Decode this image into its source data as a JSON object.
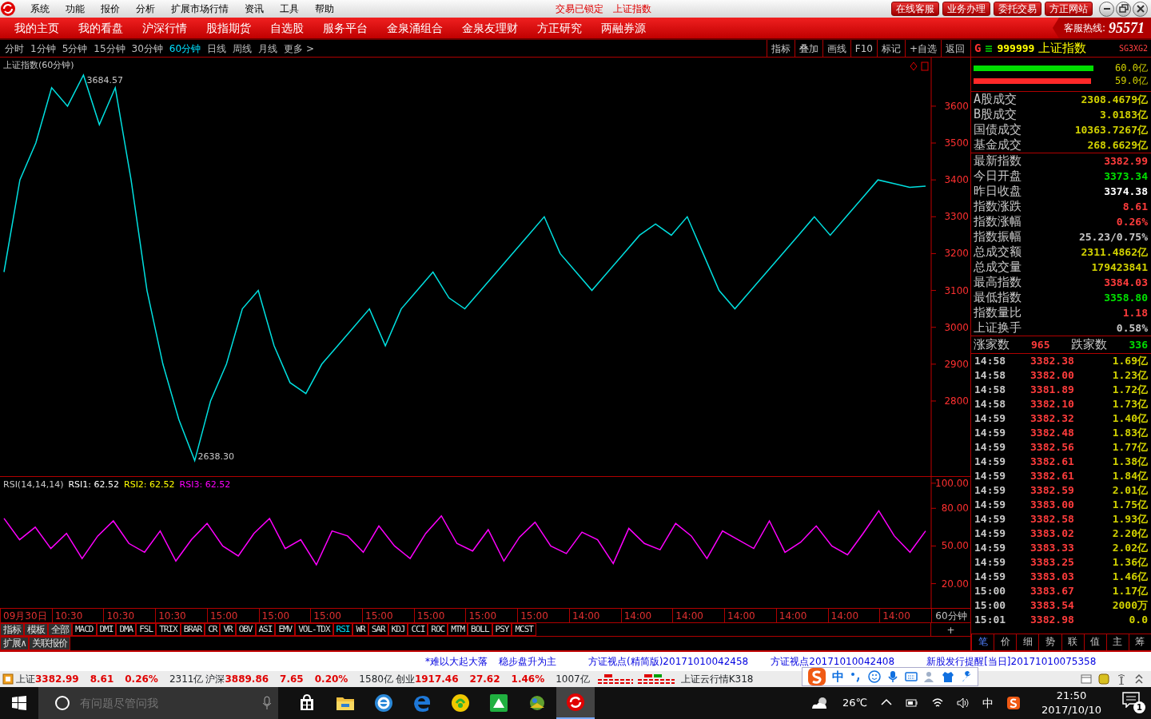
{
  "menu_bar": {
    "items": [
      "系统",
      "功能",
      "报价",
      "分析",
      "扩展市场行情",
      "资讯",
      "工具",
      "帮助"
    ],
    "status": [
      "交易已锁定",
      "上证指数"
    ],
    "buttons": [
      "在线客服",
      "业务办理",
      "委托交易",
      "方正网站"
    ]
  },
  "nav": {
    "items": [
      "我的主页",
      "我的看盘",
      "沪深行情",
      "股指期货",
      "自选股",
      "服务平台",
      "金泉涌组合",
      "金泉友理财",
      "方正研究",
      "两融券源"
    ],
    "hotline_label": "客服热线:",
    "hotline_number": "95571"
  },
  "periods": [
    {
      "label": "分时",
      "selected": false
    },
    {
      "label": "1分钟",
      "selected": false
    },
    {
      "label": "5分钟",
      "selected": false
    },
    {
      "label": "15分钟",
      "selected": false
    },
    {
      "label": "30分钟",
      "selected": false
    },
    {
      "label": "60分钟",
      "selected": true
    },
    {
      "label": "日线",
      "selected": false
    },
    {
      "label": "周线",
      "selected": false
    },
    {
      "label": "月线",
      "selected": false
    },
    {
      "label": "更多 >",
      "selected": false
    }
  ],
  "chart_tools": [
    "指标",
    "叠加",
    "画线",
    "F10",
    "标记",
    "+自选",
    "返回"
  ],
  "price_chart": {
    "title": "上证指数(60分钟)",
    "chart_data": {
      "type": "line",
      "ylim": [
        2594,
        3732
      ],
      "yticks": [
        2800,
        2900,
        3000,
        3100,
        3200,
        3300,
        3400,
        3500,
        3600
      ],
      "series": [
        {
          "color": "#00e0e0",
          "values": [
            3150,
            3400,
            3500,
            3650,
            3600,
            3684.57,
            3550,
            3650,
            3400,
            3100,
            2900,
            2750,
            2638.3,
            2800,
            2900,
            3050,
            3100,
            2950,
            2850,
            2820,
            2900,
            2950,
            3000,
            3050,
            2950,
            3050,
            3100,
            3150,
            3080,
            3050,
            3100,
            3150,
            3200,
            3250,
            3300,
            3200,
            3150,
            3100,
            3150,
            3200,
            3250,
            3280,
            3250,
            3300,
            3200,
            3100,
            3050,
            3100,
            3150,
            3200,
            3250,
            3300,
            3250,
            3300,
            3350,
            3400,
            3390,
            3380,
            3383
          ]
        }
      ],
      "annotations": [
        "3684.57",
        "2638.30"
      ]
    }
  },
  "rsi_chart": {
    "title": "RSI(14,14,14)",
    "readings": [
      {
        "label": "RSI1:",
        "value": "62.52",
        "color": "#ffffff"
      },
      {
        "label": "RSI2:",
        "value": "62.52",
        "color": "#ffff00"
      },
      {
        "label": "RSI3:",
        "value": "62.52",
        "color": "#ff00ff"
      }
    ],
    "chart_data": {
      "type": "line",
      "ylim": [
        0,
        105
      ],
      "yticks": [
        {
          "value": 20,
          "label": "20.00"
        },
        {
          "value": 50,
          "label": "50.00"
        },
        {
          "value": 80,
          "label": "80.00"
        },
        {
          "value": 100,
          "label": "100.00"
        }
      ],
      "series": [
        {
          "color": "#ff00ff",
          "values": [
            72,
            55,
            65,
            48,
            60,
            40,
            58,
            70,
            52,
            45,
            62,
            38,
            55,
            68,
            50,
            42,
            60,
            72,
            48,
            55,
            35,
            62,
            58,
            45,
            66,
            50,
            40,
            60,
            74,
            52,
            46,
            63,
            38,
            57,
            69,
            50,
            44,
            61,
            55,
            36,
            64,
            52,
            47,
            68,
            58,
            40,
            62,
            55,
            48,
            70,
            45,
            53,
            66,
            50,
            43,
            60,
            78,
            58,
            45,
            62
          ]
        }
      ]
    }
  },
  "time_axis": [
    "09月30日",
    "10:30",
    "10:30",
    "10:30",
    "15:00",
    "15:00",
    "15:00",
    "15:00",
    "15:00",
    "15:00",
    "15:00",
    "14:00",
    "14:00",
    "14:00",
    "14:00",
    "14:00",
    "14:00",
    "14:00"
  ],
  "period_label": "60分钟",
  "period_plus": "+",
  "indicator_tabs": [
    {
      "label": "指标",
      "selected": false
    },
    {
      "label": "模板",
      "selected": false
    },
    {
      "label": "全部",
      "selected": false
    },
    {
      "label": "MACD",
      "selected": false
    },
    {
      "label": "DMI",
      "selected": false
    },
    {
      "label": "DMA",
      "selected": false
    },
    {
      "label": "FSL",
      "selected": false
    },
    {
      "label": "TRIX",
      "selected": false
    },
    {
      "label": "BRAR",
      "selected": false
    },
    {
      "label": "CR",
      "selected": false
    },
    {
      "label": "VR",
      "selected": false
    },
    {
      "label": "OBV",
      "selected": false
    },
    {
      "label": "ASI",
      "selected": false
    },
    {
      "label": "EMV",
      "selected": false
    },
    {
      "label": "VOL-TDX",
      "selected": false
    },
    {
      "label": "RSI",
      "selected": true
    },
    {
      "label": "WR",
      "selected": false
    },
    {
      "label": "SAR",
      "selected": false
    },
    {
      "label": "KDJ",
      "selected": false
    },
    {
      "label": "CCI",
      "selected": false
    },
    {
      "label": "ROC",
      "selected": false
    },
    {
      "label": "MTM",
      "selected": false
    },
    {
      "label": "BOLL",
      "selected": false
    },
    {
      "label": "PSY",
      "selected": false
    },
    {
      "label": "MCST",
      "selected": false
    }
  ],
  "extra_tabs": [
    "扩展∧",
    "关联报价"
  ],
  "quote_panel": {
    "marker": "G",
    "code": "999999",
    "name": "上证指数",
    "badge": "SG3XG2",
    "bars": [
      {
        "color": "#00dd00",
        "level": 0.97,
        "value": "60.0亿"
      },
      {
        "color": "#ff2828",
        "level": 0.95,
        "value": "59.0亿"
      }
    ],
    "turnover": [
      {
        "label": "A股成交",
        "value": "2308.4679亿"
      },
      {
        "label": "B股成交",
        "value": "3.0183亿"
      },
      {
        "label": "国债成交",
        "value": "10363.7267亿"
      },
      {
        "label": "基金成交",
        "value": "268.6629亿"
      }
    ],
    "stats": [
      {
        "label": "最新指数",
        "value": "3382.99",
        "color": "#ff3c3c"
      },
      {
        "label": "今日开盘",
        "value": "3373.34",
        "color": "#00e000"
      },
      {
        "label": "昨日收盘",
        "value": "3374.38",
        "color": "#ffffff"
      },
      {
        "label": "指数涨跌",
        "value": "8.61",
        "color": "#ff3c3c"
      },
      {
        "label": "指数涨幅",
        "value": "0.26%",
        "color": "#ff3c3c"
      },
      {
        "label": "指数振幅",
        "value": "25.23/0.75%",
        "color": "#c8c8c8"
      },
      {
        "label": "总成交额",
        "value": "2311.4862亿",
        "color": "#d2d200"
      },
      {
        "label": "总成交量",
        "value": "179423841",
        "color": "#d2d200"
      },
      {
        "label": "最高指数",
        "value": "3384.03",
        "color": "#ff3c3c"
      },
      {
        "label": "最低指数",
        "value": "3358.80",
        "color": "#00e000"
      },
      {
        "label": "指数量比",
        "value": "1.18",
        "color": "#ff3c3c"
      },
      {
        "label": "上证换手",
        "value": "0.58%",
        "color": "#c8c8c8"
      }
    ],
    "breadth": {
      "up_label": "涨家数",
      "up": "965",
      "down_label": "跌家数",
      "down": "336"
    },
    "ticks": [
      {
        "time": "14:58",
        "price": "3382.38",
        "volume": "1.69亿"
      },
      {
        "time": "14:58",
        "price": "3382.00",
        "volume": "1.23亿"
      },
      {
        "time": "14:58",
        "price": "3381.89",
        "volume": "1.72亿"
      },
      {
        "time": "14:58",
        "price": "3382.10",
        "volume": "1.73亿"
      },
      {
        "time": "14:59",
        "price": "3382.32",
        "volume": "1.40亿"
      },
      {
        "time": "14:59",
        "price": "3382.48",
        "volume": "1.83亿"
      },
      {
        "time": "14:59",
        "price": "3382.56",
        "volume": "1.77亿"
      },
      {
        "time": "14:59",
        "price": "3382.61",
        "volume": "1.38亿"
      },
      {
        "time": "14:59",
        "price": "3382.61",
        "volume": "1.84亿"
      },
      {
        "time": "14:59",
        "price": "3382.59",
        "volume": "2.01亿"
      },
      {
        "time": "14:59",
        "price": "3383.00",
        "volume": "1.75亿"
      },
      {
        "time": "14:59",
        "price": "3382.58",
        "volume": "1.93亿"
      },
      {
        "time": "14:59",
        "price": "3383.02",
        "volume": "2.20亿"
      },
      {
        "time": "14:59",
        "price": "3383.33",
        "volume": "2.02亿"
      },
      {
        "time": "14:59",
        "price": "3383.25",
        "volume": "1.36亿"
      },
      {
        "time": "14:59",
        "price": "3383.03",
        "volume": "1.46亿"
      },
      {
        "time": "15:00",
        "price": "3383.67",
        "volume": "1.17亿"
      },
      {
        "time": "15:00",
        "price": "3383.54",
        "volume": "2000万"
      },
      {
        "time": "15:01",
        "price": "3382.98",
        "volume": "0.0"
      }
    ],
    "tabs": [
      {
        "label": "笔",
        "selected": true
      },
      {
        "label": "价",
        "selected": false
      },
      {
        "label": "细",
        "selected": false
      },
      {
        "label": "势",
        "selected": false
      },
      {
        "label": "联",
        "selected": false
      },
      {
        "label": "值",
        "selected": false
      },
      {
        "label": "主",
        "selected": false
      },
      {
        "label": "筹",
        "selected": false
      }
    ]
  },
  "news": [
    "*难以大起大落",
    "稳步盘升为主",
    "方证视点(精简版)20171010042458",
    "方证视点20171010042408",
    "新股发行提醒[当日]20171010075358"
  ],
  "indices": [
    {
      "name": "上证",
      "value": "3382.99",
      "change": "8.61",
      "pct": "0.26%",
      "amount": "2311亿"
    },
    {
      "name": "沪深",
      "value": "3889.86",
      "change": "7.65",
      "pct": "0.20%",
      "amount": "1580亿"
    },
    {
      "name": "创业",
      "value": "1917.46",
      "change": "27.62",
      "pct": "1.46%",
      "amount": "1007亿"
    }
  ],
  "ticker_label": "上证云行情K318",
  "ime_toolbar": {
    "mode": "中"
  },
  "taskbar": {
    "search_placeholder": "有问题尽管问我",
    "temperature": "26℃",
    "ime": "中",
    "time": "21:50",
    "date": "2017/10/10",
    "notifications": "1"
  }
}
